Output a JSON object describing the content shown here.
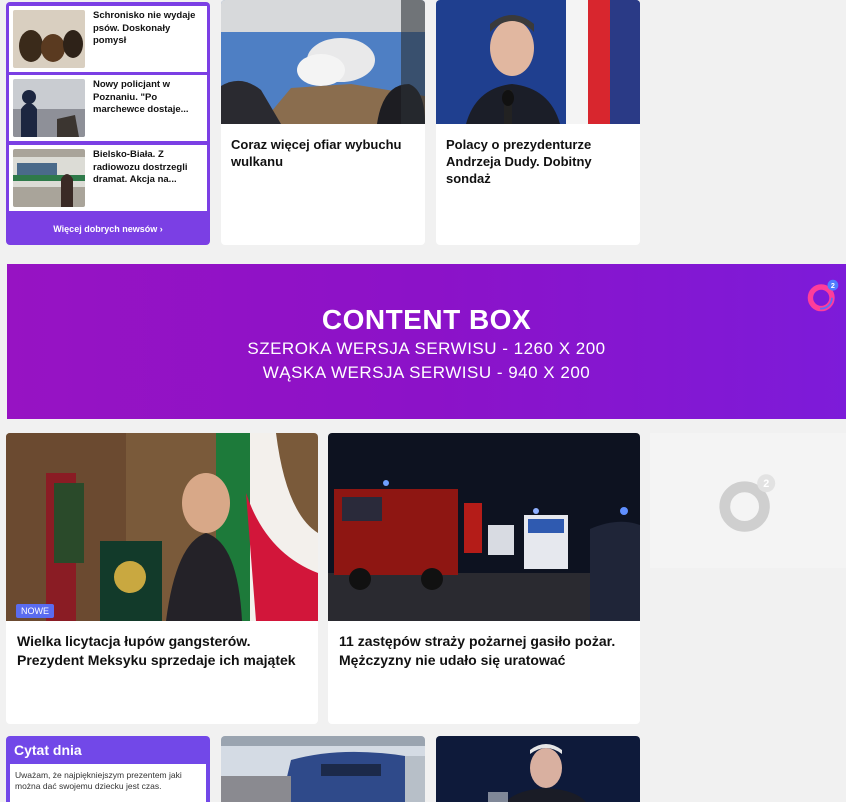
{
  "good_news": {
    "items": [
      {
        "title": "Schronisko nie wydaje psów. Doskonały pomysł"
      },
      {
        "title": "Nowy policjant w Poznaniu. \"Po marchewce dostaje..."
      },
      {
        "title": "Bielsko-Biała. Z radiowozu dostrzegli dramat. Akcja na..."
      }
    ],
    "more_link": "Więcej dobrych newsów ›"
  },
  "top_cards": [
    {
      "headline": "Coraz więcej ofiar wybuchu wulkanu"
    },
    {
      "headline": "Polacy o prezydenturze Andrzeja Dudy. Dobitny sondaż"
    }
  ],
  "content_box": {
    "title": "CONTENT BOX",
    "line1": "SZEROKA WERSJA SERWISU - 1260 X 200",
    "line2": "WĄSKA WERSJA SERWISU - 940 X 200",
    "logo_mark": "2"
  },
  "mid_cards": [
    {
      "headline": "Wielka licytacja łupów gangsterów. Prezydent Meksyku sprzedaje ich majątek",
      "badge": "NOWE"
    },
    {
      "headline": "11 zastępów straży pożarnej gasiło pożar. Mężczyzny nie udało się uratować"
    }
  ],
  "ad_placeholder": {
    "logo_mark": "2"
  },
  "quote": {
    "title": "Cytat dnia",
    "text": "Uważam, że najpiękniejszym prezentem jaki można dać swojemu dziecku jest czas."
  },
  "colors": {
    "purple": "#7b3fe4",
    "content_box": "#9713c3",
    "badge": "#5a6cf0"
  }
}
